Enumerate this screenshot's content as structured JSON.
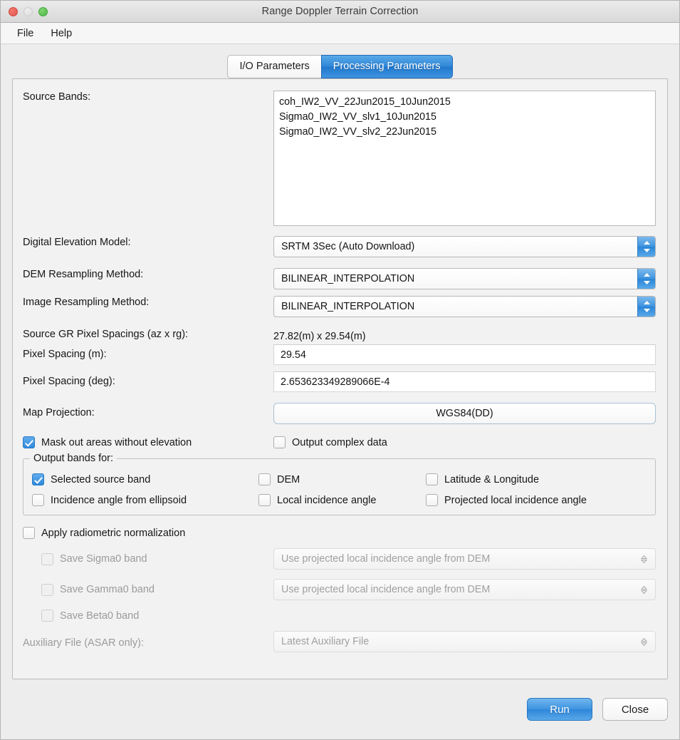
{
  "window": {
    "title": "Range Doppler Terrain Correction",
    "traffic_lights": [
      "close-light",
      "minimize-light",
      "zoom-light"
    ]
  },
  "menubar": {
    "items": [
      {
        "label": "File"
      },
      {
        "label": "Help"
      }
    ]
  },
  "tabs": [
    {
      "label": "I/O Parameters",
      "active": false
    },
    {
      "label": "Processing Parameters",
      "active": true
    }
  ],
  "form": {
    "source_bands": {
      "label": "Source Bands:",
      "items": [
        "coh_IW2_VV_22Jun2015_10Jun2015",
        "Sigma0_IW2_VV_slv1_10Jun2015",
        "Sigma0_IW2_VV_slv2_22Jun2015"
      ]
    },
    "dem": {
      "label": "Digital Elevation Model:",
      "value": "SRTM 3Sec (Auto Download)"
    },
    "dem_resampling": {
      "label": "DEM Resampling Method:",
      "value": "BILINEAR_INTERPOLATION"
    },
    "image_resampling": {
      "label": "Image Resampling Method:",
      "value": "BILINEAR_INTERPOLATION"
    },
    "source_gr_spacing": {
      "label": "Source GR Pixel Spacings (az x rg):",
      "value": "27.82(m) x 29.54(m)"
    },
    "pixel_spacing_m": {
      "label": "Pixel Spacing (m):",
      "value": "29.54"
    },
    "pixel_spacing_deg": {
      "label": "Pixel Spacing (deg):",
      "value": "2.653623349289066E-4"
    },
    "map_projection": {
      "label": "Map Projection:",
      "value": "WGS84(DD)"
    },
    "mask_out_elevation": {
      "label": "Mask out areas without elevation",
      "checked": true
    },
    "output_complex": {
      "label": "Output complex data",
      "checked": false
    },
    "output_bands_group": {
      "title": "Output bands for:",
      "checkboxes": [
        {
          "label": "Selected source band",
          "checked": true
        },
        {
          "label": "DEM",
          "checked": false
        },
        {
          "label": "Latitude & Longitude",
          "checked": false
        },
        {
          "label": "Incidence angle from ellipsoid",
          "checked": false
        },
        {
          "label": "Local incidence angle",
          "checked": false
        },
        {
          "label": "Projected local incidence angle",
          "checked": false
        }
      ]
    },
    "apply_radiometric": {
      "label": "Apply radiometric normalization",
      "checked": false
    },
    "save_sigma0": {
      "label": "Save Sigma0 band",
      "checked": false,
      "combo": "Use projected local incidence angle from DEM"
    },
    "save_gamma0": {
      "label": "Save Gamma0 band",
      "checked": false,
      "combo": "Use projected local incidence angle from DEM"
    },
    "save_beta0": {
      "label": "Save Beta0 band",
      "checked": false
    },
    "auxiliary_file": {
      "label": "Auxiliary File (ASAR only):",
      "value": "Latest Auxiliary File"
    }
  },
  "footer": {
    "run_label": "Run",
    "close_label": "Close"
  },
  "colors": {
    "accent": "#2f86d6",
    "window_bg": "#ededed",
    "panel_bg": "#f2f2f2"
  }
}
